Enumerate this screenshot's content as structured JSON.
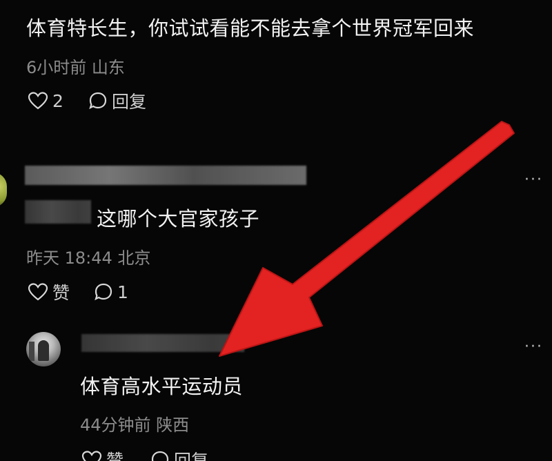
{
  "comments": [
    {
      "text": "体育特长生，你试试看能不能去拿个世界冠军回来",
      "meta": "6小时前 山东",
      "like_count": "2",
      "reply_label": "回复"
    },
    {
      "text": "这哪个大官家孩子",
      "meta": "昨天 18:44 北京",
      "like_label": "赞",
      "reply_count": "1",
      "more": "···"
    },
    {
      "text": "体育高水平运动员",
      "meta": "44分钟前 陕西",
      "like_label": "赞",
      "reply_label": "回复",
      "more": "···"
    }
  ],
  "annotation": {
    "arrow_color": "#e32222"
  }
}
